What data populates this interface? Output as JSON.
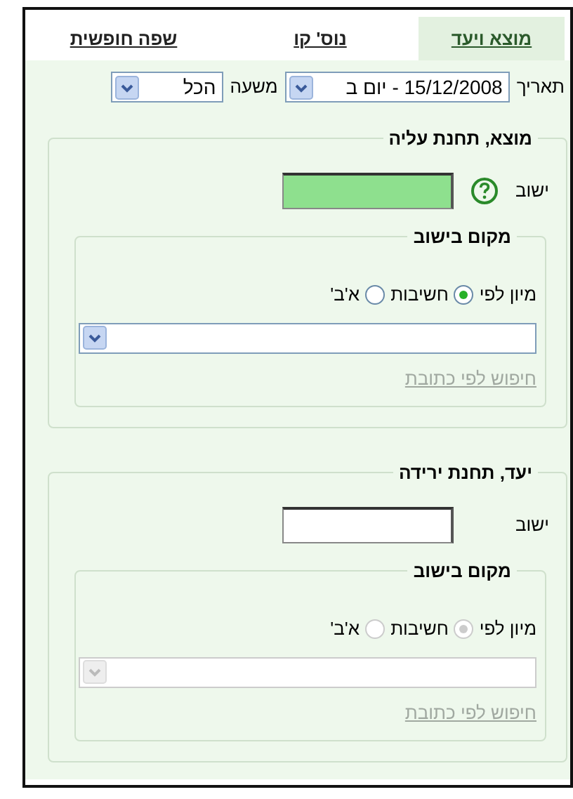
{
  "tabs": [
    {
      "label": "מוצא ויעד",
      "selected": true
    },
    {
      "label": "נוס' קו",
      "selected": false
    },
    {
      "label": "שפה חופשית",
      "selected": false
    }
  ],
  "date_row": {
    "date_label": "תאריך",
    "date_value": "15/12/2008 - יום ב",
    "hour_label": "משעה",
    "hour_value": "הכל"
  },
  "sections": [
    {
      "legend": "מוצא, תחנת עליה",
      "settlement_label": "ישוב",
      "focused": true,
      "help": true,
      "place": {
        "legend": "מקום בישוב",
        "sort_label": "מיון לפי",
        "disabled": false,
        "options": [
          {
            "label": "חשיבות",
            "selected": true
          },
          {
            "label": "א'ב'",
            "selected": false
          }
        ],
        "link": "חיפוש לפי כתובת"
      }
    },
    {
      "legend": "יעד, תחנת ירידה",
      "settlement_label": "ישוב",
      "focused": false,
      "help": false,
      "place": {
        "legend": "מקום בישוב",
        "sort_label": "מיון לפי",
        "disabled": true,
        "options": [
          {
            "label": "חשיבות",
            "selected": true
          },
          {
            "label": "א'ב'",
            "selected": false
          }
        ],
        "link": "חיפוש לפי כתובת"
      }
    }
  ]
}
